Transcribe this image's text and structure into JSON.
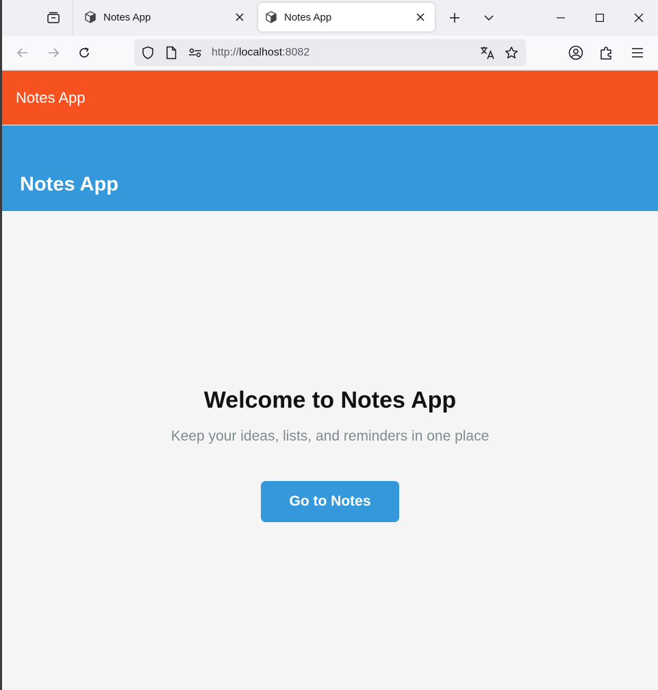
{
  "browser": {
    "tabs": [
      {
        "title": "Notes App",
        "active": false,
        "icon": "cube-favicon-icon"
      },
      {
        "title": "Notes App",
        "active": true,
        "icon": "cube-favicon-icon"
      }
    ],
    "url": {
      "scheme": "http://",
      "host": "localhost",
      "port": ":8082"
    }
  },
  "app": {
    "topbar_title": "Notes App",
    "header_title": "Notes App",
    "welcome": {
      "title": "Welcome to Notes App",
      "subtitle": "Keep your ideas, lists, and reminders in one place",
      "cta_label": "Go to Notes"
    }
  },
  "colors": {
    "topbar": "#f5521f",
    "header": "#3498db",
    "button": "#3498db",
    "page_background": "#f5f5f5",
    "subtitle_text": "#7f8c8d"
  }
}
